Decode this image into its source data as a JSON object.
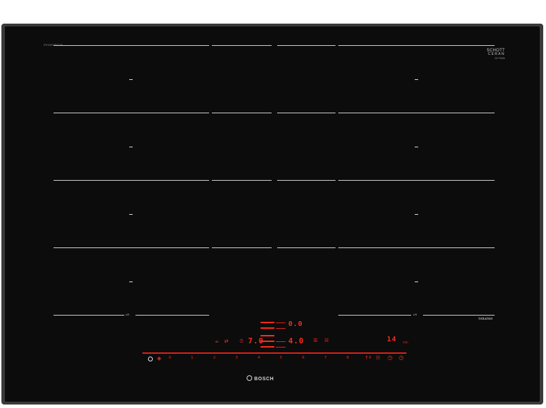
{
  "hob": {
    "model_number": "PXV875DC1E",
    "brand_line1": "SCHOTT",
    "brand_line2": "CERAN",
    "brand_line3": "DE PM66",
    "logo_text": "BOSCH",
    "induction_label": "Induction",
    "flex_label_left": "LR",
    "flex_label_right": "LR"
  },
  "displays": {
    "top_center": "0.0",
    "left_power": "7.0",
    "center_power": "4.0",
    "right_timer": "14",
    "right_timer_unit": "min"
  },
  "slider_scale": [
    "0",
    "1",
    "2",
    "3",
    "4",
    "5",
    "6",
    "7",
    "8",
    "9"
  ],
  "icons": {
    "power": "power-icon",
    "child_lock": "child-lock-icon",
    "boost": "boost-icon",
    "timer": "timer-icon",
    "frying": "frying-sensor-icon",
    "move": "move-icon",
    "flex": "flex-zone-icon",
    "keep_warm": "keep-warm-icon",
    "stopwatch": "stopwatch-icon"
  },
  "colors": {
    "glass": "#0c0c0c",
    "frame": "#3a3a3a",
    "display_red": "#ff2a1a",
    "zone_lines": "#cfcfcf"
  }
}
